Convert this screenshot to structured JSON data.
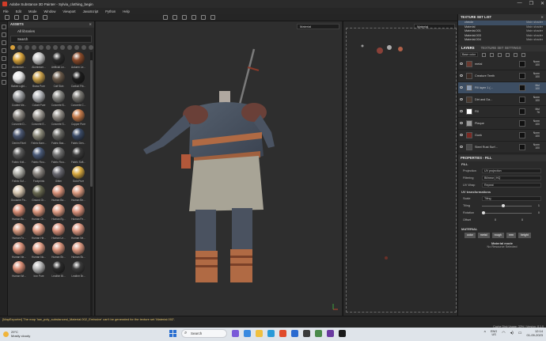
{
  "window": {
    "title": "Adobe Substance 3D Painter - Sylvia_clothing_begin",
    "controls": [
      "—",
      "❐",
      "✕"
    ]
  },
  "menu": [
    "File",
    "Edit",
    "Mode",
    "Window",
    "Viewport",
    "JavaScript",
    "Python",
    "Help"
  ],
  "assets": {
    "header": "ASSETS",
    "library": "All libraries",
    "search_placeholder": "Search",
    "materials": [
      {
        "name": "Aluminium...",
        "color": "#d9a43c"
      },
      {
        "name": "Aluminium...",
        "color": "#c8c8c8"
      },
      {
        "name": "Artificial Le...",
        "color": "#2b2b2b"
      },
      {
        "name": "Autumn Le...",
        "color": "#8a4a2a"
      },
      {
        "name": "Baked Light...",
        "color": "#e8e8e8"
      },
      {
        "name": "Brass Pure",
        "color": "#c9a04a"
      },
      {
        "name": "Calf Skin",
        "color": "#6a5a4a"
      },
      {
        "name": "Carbon Fib...",
        "color": "#1c1c1c"
      },
      {
        "name": "Coated Me...",
        "color": "#9ea0a3"
      },
      {
        "name": "Cobalt Pure",
        "color": "#b4b6ba"
      },
      {
        "name": "Concrete B...",
        "color": "#8a8a86"
      },
      {
        "name": "Concrete C...",
        "color": "#7a7873"
      },
      {
        "name": "Concrete D...",
        "color": "#8e8a84"
      },
      {
        "name": "Concrete E...",
        "color": "#a09c96"
      },
      {
        "name": "Concrete S...",
        "color": "#94908a"
      },
      {
        "name": "Copper Pure",
        "color": "#c47a4a"
      },
      {
        "name": "Denim Rivet",
        "color": "#4a5670"
      },
      {
        "name": "Fabric Bam...",
        "color": "#8c8a7a"
      },
      {
        "name": "Fabric Bas...",
        "color": "#6a6a66"
      },
      {
        "name": "Fabric Den...",
        "color": "#3a4a66"
      },
      {
        "name": "Fabric Knit...",
        "color": "#5a5a5a"
      },
      {
        "name": "Fabric Rou...",
        "color": "#4a5a78"
      },
      {
        "name": "Fabric Rou...",
        "color": "#707070"
      },
      {
        "name": "Fabric Soft...",
        "color": "#3a3a3a"
      },
      {
        "name": "Fabric Suf...",
        "color": "#b0b0aa"
      },
      {
        "name": "Footprints",
        "color": "#8a8580"
      },
      {
        "name": "Glitter",
        "color": "#6a6a72"
      },
      {
        "name": "Gold Pure",
        "color": "#d9aa40"
      },
      {
        "name": "Gouache Pa...",
        "color": "#d6c6b0"
      },
      {
        "name": "Ground Gr...",
        "color": "#6a6a52"
      },
      {
        "name": "Human Ba...",
        "color": "#d9927a"
      },
      {
        "name": "Human Be...",
        "color": "#dc9a80"
      },
      {
        "name": "Human Bu...",
        "color": "#d88c74"
      },
      {
        "name": "Human Ch...",
        "color": "#db957c"
      },
      {
        "name": "Human Ey...",
        "color": "#e09c84"
      },
      {
        "name": "Human Fe...",
        "color": "#d9907a"
      },
      {
        "name": "Human Fo...",
        "color": "#d6987e"
      },
      {
        "name": "Human He...",
        "color": "#df9a82"
      },
      {
        "name": "Human Le...",
        "color": "#d88e78"
      },
      {
        "name": "Human Ne...",
        "color": "#dc9680"
      },
      {
        "name": "Human Ne...",
        "color": "#d99078"
      },
      {
        "name": "Human No...",
        "color": "#e29e86"
      },
      {
        "name": "Human Sh...",
        "color": "#d8927a"
      },
      {
        "name": "Human Sk...",
        "color": "#dc9880"
      },
      {
        "name": "Human Wr...",
        "color": "#d98e76"
      },
      {
        "name": "Iron Pure",
        "color": "#b8b8b8"
      },
      {
        "name": "Leather Bl...",
        "color": "#2a2a2a"
      },
      {
        "name": "Leather Br...",
        "color": "#3a3a3a"
      }
    ]
  },
  "viewport": {
    "material_mode_3d": "Material",
    "material_mode_2d": "Material"
  },
  "texture_sets": {
    "header": "TEXTURE SET LIST",
    "items": [
      {
        "name": "checkr",
        "shader": "Main shader"
      },
      {
        "name": "Material",
        "shader": "Main shader"
      },
      {
        "name": "Material.001",
        "shader": "Main shader"
      },
      {
        "name": "Material.003",
        "shader": "Main shader"
      },
      {
        "name": "Material.004",
        "shader": "Main shader"
      }
    ]
  },
  "layers": {
    "tabs": [
      "LAYERS",
      "TEXTURE SET SETTINGS"
    ],
    "blend_mode": "Base color",
    "items": [
      {
        "name": "metal",
        "blend": "Norm",
        "opacity": "100",
        "thumb": "#6a3a30"
      },
      {
        "name": "Creature Teeth",
        "blend": "Norm",
        "opacity": "100",
        "thumb": "#3a2a24"
      },
      {
        "name": "Fill layer 1 (...",
        "blend": "Mul",
        "opacity": "100",
        "thumb": "#8a9ab0"
      },
      {
        "name": "Dirt and Da...",
        "blend": "Norm",
        "opacity": "100",
        "thumb": "#4a3a30"
      },
      {
        "name": "Fill",
        "blend": "Mul",
        "opacity": "76",
        "thumb": "#ffffff"
      },
      {
        "name": "Plaque",
        "blend": "Norm",
        "opacity": "100",
        "thumb": "#9a9a9a"
      },
      {
        "name": "Gunk",
        "blend": "Norm",
        "opacity": "100",
        "thumb": "#7a2a24"
      },
      {
        "name": "Steel Rust Surf...",
        "blend": "Norm",
        "opacity": "100",
        "thumb": "#4a4a4a"
      }
    ]
  },
  "properties": {
    "header": "PROPERTIES - FILL",
    "fill_title": "FILL",
    "projection": {
      "label": "Projection",
      "value": "UV projection"
    },
    "filtering": {
      "label": "Filtering",
      "value": "Bilinear | HQ"
    },
    "uv_wrap": {
      "label": "UV Wrap",
      "value": "Repeat"
    },
    "uv_section": "UV transformations",
    "scale": {
      "label": "Scale",
      "value": "Tiling"
    },
    "tiling": {
      "label": "Tiling",
      "value": "1"
    },
    "rotation": {
      "label": "Rotation",
      "value": "0"
    },
    "offset": {
      "label": "Offset",
      "value_x": "0",
      "value_y": "0"
    },
    "material_title": "MATERIAL",
    "channels": [
      "color",
      "metal",
      "rough",
      "nrm",
      "height"
    ],
    "material_mode": "Material mode",
    "resource": "No Resource Selected"
  },
  "status": {
    "message": "[MapExporter] The map 'low_poly_substancesl_Material.002_Emissive' can't be generated for the texture set 'Material.002'.",
    "cache": "Cache Disk Usage:  33%  |  Version: 8.1.0"
  },
  "taskbar": {
    "temp": "29°C",
    "weather": "Mostly cloudy",
    "search": "Search",
    "lang_top": "ENG",
    "lang_bottom": "US",
    "time": "12:14",
    "date": "01-09-2023"
  }
}
